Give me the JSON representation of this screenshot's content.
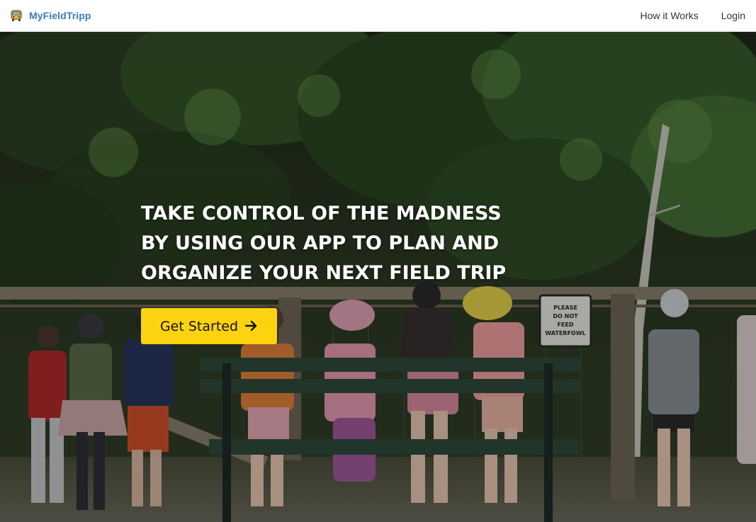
{
  "navbar": {
    "brand": {
      "name": "MyFieldTripp",
      "icon": "school-bus-icon"
    },
    "links": [
      {
        "label": "How it Works"
      },
      {
        "label": "Login"
      }
    ]
  },
  "hero": {
    "headline_lines": [
      "TAKE CONTROL OF THE MADNESS",
      "BY USING OUR APP TO PLAN AND",
      "ORGANIZE YOUR NEXT FIELD TRIP"
    ],
    "cta": {
      "label": "Get Started",
      "icon": "arrow-right-icon"
    },
    "background_image": {
      "sign_text": [
        "PLEASE",
        "DO NOT",
        "FEED",
        "WATERFOWL"
      ]
    }
  },
  "colors": {
    "brand": "#3a7bbf",
    "cta_background": "#fdd30f",
    "nav_text": "#333333",
    "headline_text": "#ffffff"
  }
}
